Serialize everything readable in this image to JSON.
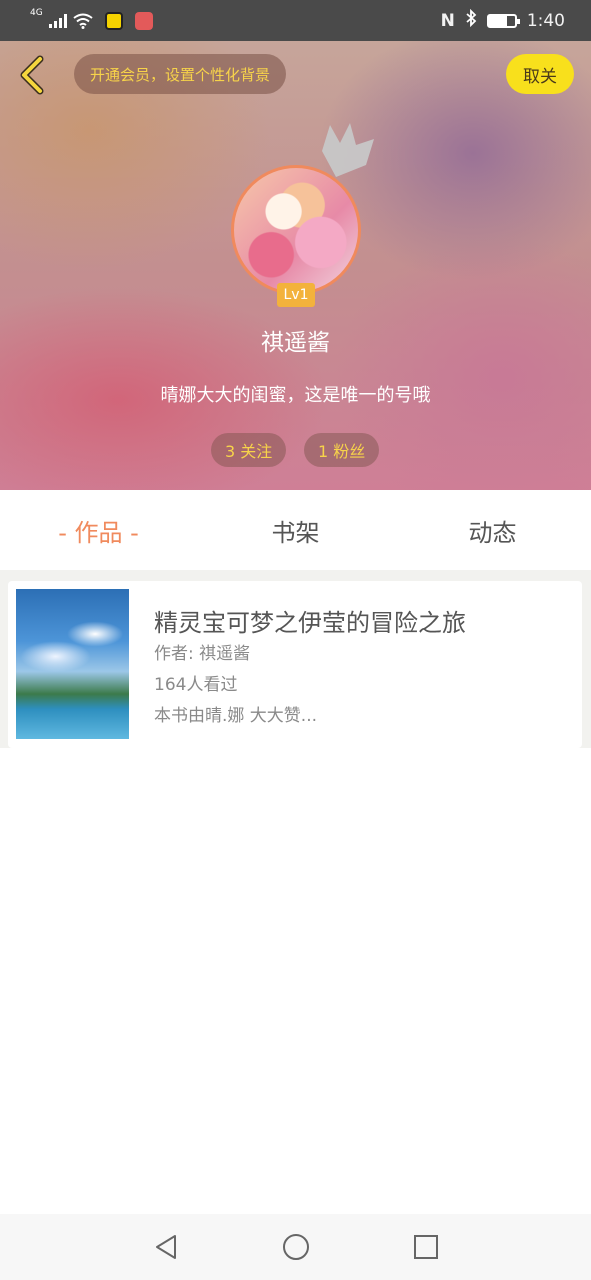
{
  "status_bar": {
    "network": "4G",
    "time": "1:40",
    "nfc": "N"
  },
  "header": {
    "vip_prompt": "开通会员，设置个性化背景",
    "close_label": "取关",
    "level": "Lv1",
    "username": "祺遥酱",
    "bio": "晴娜大大的闺蜜，这是唯一的号哦",
    "following": "3 关注",
    "followers": "1 粉丝"
  },
  "tabs": [
    {
      "label": "- 作品 -",
      "active": true
    },
    {
      "label": "书架",
      "active": false
    },
    {
      "label": "动态",
      "active": false
    }
  ],
  "books": [
    {
      "title": "精灵宝可梦之伊莹的冒险之旅",
      "author": "作者: 祺遥酱",
      "views": "164人看过",
      "desc": "本书由晴.娜 大大赞..."
    }
  ],
  "colors": {
    "accent": "#f08a5d",
    "vip_text": "#f7d34a",
    "close_bg": "#f8e01c",
    "level_bg": "#f3b23c"
  },
  "icons": {
    "back": "chevron-left-icon",
    "crown": "crown-icon",
    "nav_back": "triangle-back-icon",
    "nav_home": "circle-home-icon",
    "nav_recent": "square-recent-icon"
  }
}
